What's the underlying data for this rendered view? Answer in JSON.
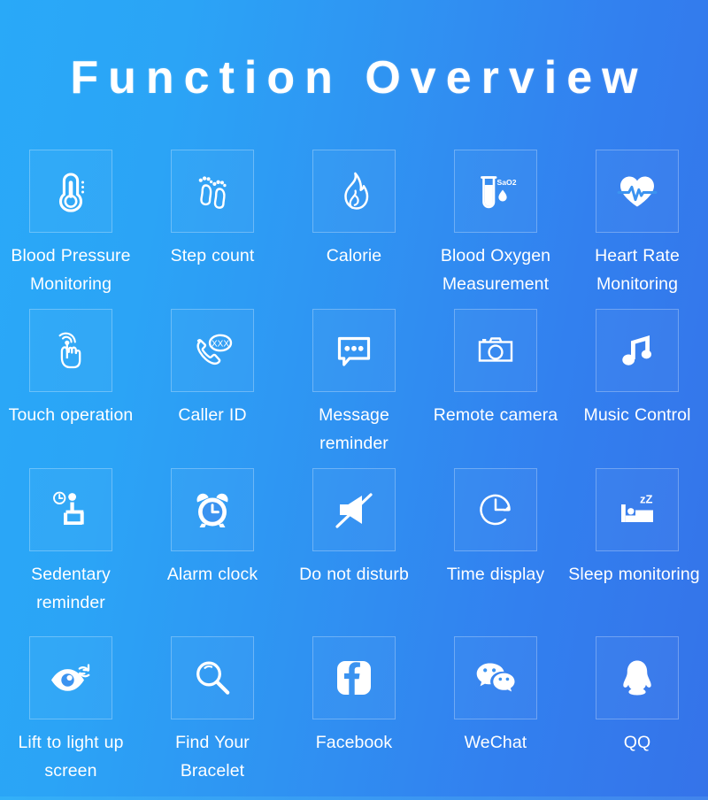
{
  "page": {
    "title": "Function Overview",
    "background_gradient_from": "#29a9f8",
    "background_gradient_to": "#3573e9",
    "text_color": "#ffffff",
    "tile_border_color": "rgba(255,255,255,0.28)"
  },
  "features": [
    {
      "icon": "thermometer-icon",
      "label": "Blood Pressure Monitoring",
      "badge": ""
    },
    {
      "icon": "footprints-icon",
      "label": "Step count",
      "badge": ""
    },
    {
      "icon": "flame-icon",
      "label": "Calorie",
      "badge": ""
    },
    {
      "icon": "test-tube-icon",
      "label": "Blood Oxygen Measurement",
      "badge": "SaO2"
    },
    {
      "icon": "heart-pulse-icon",
      "label": "Heart Rate Monitoring",
      "badge": ""
    },
    {
      "icon": "touch-gesture-icon",
      "label": "Touch operation",
      "badge": ""
    },
    {
      "icon": "phone-caller-icon",
      "label": "Caller ID",
      "badge": "XXX"
    },
    {
      "icon": "speech-bubble-icon",
      "label": "Message reminder",
      "badge": ""
    },
    {
      "icon": "camera-icon",
      "label": "Remote camera",
      "badge": ""
    },
    {
      "icon": "music-note-icon",
      "label": "Music Control",
      "badge": ""
    },
    {
      "icon": "sitting-person-clock-icon",
      "label": "Sedentary reminder",
      "badge": ""
    },
    {
      "icon": "alarm-clock-icon",
      "label": "Alarm clock",
      "badge": ""
    },
    {
      "icon": "mute-speaker-icon",
      "label": "Do not disturb",
      "badge": ""
    },
    {
      "icon": "clock-arrow-icon",
      "label": "Time display",
      "badge": ""
    },
    {
      "icon": "bed-sleep-icon",
      "label": "Sleep monitoring",
      "badge": "zZ"
    },
    {
      "icon": "eye-refresh-icon",
      "label": "Lift to light up screen",
      "badge": ""
    },
    {
      "icon": "magnifier-icon",
      "label": "Find Your Bracelet",
      "badge": ""
    },
    {
      "icon": "facebook-icon",
      "label": "Facebook",
      "badge": ""
    },
    {
      "icon": "wechat-icon",
      "label": "WeChat",
      "badge": ""
    },
    {
      "icon": "qq-penguin-icon",
      "label": "QQ",
      "badge": ""
    }
  ]
}
